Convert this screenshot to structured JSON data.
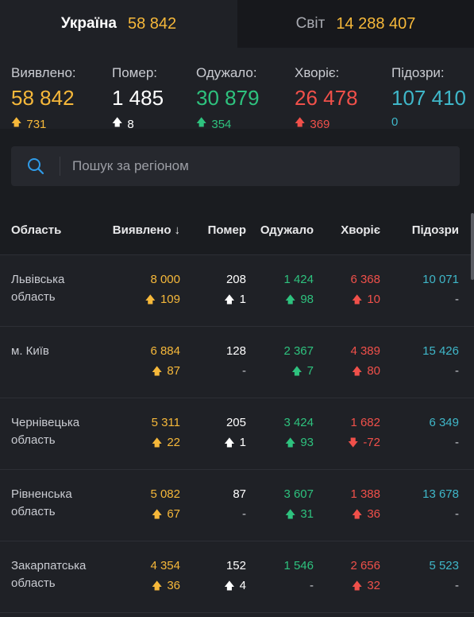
{
  "tabs": [
    {
      "name": "Україна",
      "value": "58 842",
      "active": true
    },
    {
      "name": "Світ",
      "value": "14 288 407",
      "active": false
    }
  ],
  "summary": [
    {
      "label": "Виявлено:",
      "value": "58 842",
      "delta": "731",
      "color": "#f6b83a",
      "arrow": "up"
    },
    {
      "label": "Помер:",
      "value": "1 485",
      "delta": "8",
      "color": "#ffffff",
      "arrow": "up"
    },
    {
      "label": "Одужало:",
      "value": "30 879",
      "delta": "354",
      "color": "#2ec27e",
      "arrow": "up"
    },
    {
      "label": "Хворіє:",
      "value": "26 478",
      "delta": "369",
      "color": "#f0504a",
      "arrow": "up"
    },
    {
      "label": "Підозри:",
      "value": "107 410",
      "delta": "0",
      "color": "#3fb7c9",
      "arrow": "none"
    }
  ],
  "search": {
    "placeholder": "Пошук за регіоном",
    "icon": "search-icon"
  },
  "table": {
    "headers": {
      "region": "Область",
      "detected": "Виявлено",
      "died": "Помер",
      "recovered": "Одужало",
      "sick": "Хворіє",
      "suspected": "Підозри"
    },
    "sort_icon": "arrow-down-icon",
    "rows": [
      {
        "region": "Львівська область",
        "detected": "8 000",
        "detected_delta": "109",
        "died": "208",
        "died_delta": "1",
        "recovered": "1 424",
        "recovered_delta": "98",
        "sick": "6 368",
        "sick_delta": "10",
        "sick_dir": "up",
        "suspected": "10 071",
        "suspected_delta": "-"
      },
      {
        "region": "м. Київ",
        "detected": "6 884",
        "detected_delta": "87",
        "died": "128",
        "died_delta": "-",
        "recovered": "2 367",
        "recovered_delta": "7",
        "sick": "4 389",
        "sick_delta": "80",
        "sick_dir": "up",
        "suspected": "15 426",
        "suspected_delta": "-"
      },
      {
        "region": "Чернівецька область",
        "detected": "5 311",
        "detected_delta": "22",
        "died": "205",
        "died_delta": "1",
        "recovered": "3 424",
        "recovered_delta": "93",
        "sick": "1 682",
        "sick_delta": "-72",
        "sick_dir": "down",
        "suspected": "6 349",
        "suspected_delta": "-"
      },
      {
        "region": "Рівненська область",
        "detected": "5 082",
        "detected_delta": "67",
        "died": "87",
        "died_delta": "-",
        "recovered": "3 607",
        "recovered_delta": "31",
        "sick": "1 388",
        "sick_delta": "36",
        "sick_dir": "up",
        "suspected": "13 678",
        "suspected_delta": "-"
      },
      {
        "region": "Закарпатська область",
        "detected": "4 354",
        "detected_delta": "36",
        "died": "152",
        "died_delta": "4",
        "recovered": "1 546",
        "recovered_delta": "-",
        "sick": "2 656",
        "sick_delta": "32",
        "sick_dir": "up",
        "suspected": "5 523",
        "suspected_delta": "-"
      }
    ]
  }
}
